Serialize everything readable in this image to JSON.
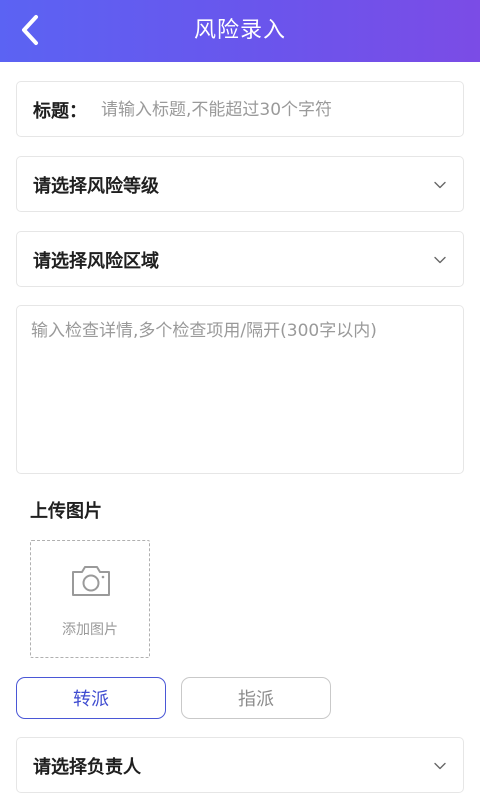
{
  "header": {
    "title": "风险录入",
    "back_icon": "chevron-left-icon",
    "gradient": [
      "#5b63f3",
      "#7b4ce6"
    ]
  },
  "form": {
    "title_label": "标题：",
    "title_placeholder": "请输入标题,不能超过30个字符",
    "risk_level_label": "请选择风险等级",
    "risk_area_label": "请选择风险区域",
    "detail_placeholder": "输入检查详情,多个检查项用/隔开(300字以内)",
    "upload_label": "上传图片",
    "add_image_text": "添加图片",
    "responsible_label": "请选择负责人"
  },
  "assign": {
    "transfer_label": "转派",
    "designate_label": "指派",
    "active": "转派",
    "active_color": "#3e4bd0"
  }
}
